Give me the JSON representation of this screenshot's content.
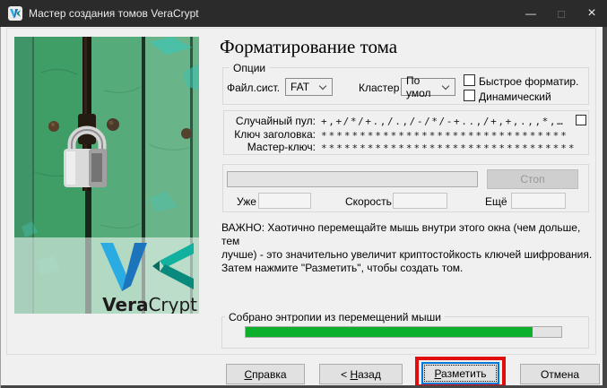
{
  "window": {
    "title": "Мастер создания томов VeraCrypt"
  },
  "icons": {
    "app": "veracrypt-logo",
    "minimize": "—",
    "maximize": "□",
    "close": "×"
  },
  "heading": "Форматирование тома",
  "options_group": {
    "label": "Опции",
    "filesystem_label": "Файл.сист.",
    "filesystem_value": "FAT",
    "cluster_label": "Кластер",
    "cluster_value": "По умол",
    "quick_format_label": "Быстрое форматир.",
    "dynamic_label": "Динамический"
  },
  "random_group": {
    "rows": [
      {
        "label": "Случайный пул:",
        "value": "+,+/*/+.,/.,/-/*/-+..,/+,+,.,,*,…"
      },
      {
        "label": "Ключ заголовка:",
        "value": "********************************"
      },
      {
        "label": "Мастер-ключ:",
        "value": "*********************************"
      }
    ]
  },
  "progress_group": {
    "stop_label": "Стоп",
    "done_label": "Уже",
    "done_value": "",
    "speed_label": "Скорость",
    "speed_value": "",
    "left_label": "Ещё",
    "left_value": ""
  },
  "notice": {
    "line1": "ВАЖНО: Хаотично перемещайте мышь внутри этого окна (чем дольше, тем",
    "line2": "лучше) - это значительно увеличит криптостойкость ключей шифрования.",
    "line3": "Затем нажмите \"Разметить\", чтобы создать том."
  },
  "entropy_group": {
    "label": "Собрано энтропии из перемещений мыши",
    "percent": 91
  },
  "footer": {
    "help": {
      "pre": "",
      "key": "С",
      "rest": "правка"
    },
    "back": {
      "pre": "< ",
      "key": "Н",
      "rest": "азад"
    },
    "format": {
      "pre": "",
      "key": "Р",
      "rest": "азметить"
    },
    "cancel": "Отмена"
  },
  "logo": {
    "vera": "Vera",
    "crypt": "Crypt"
  },
  "colors": {
    "titlebar": "#2b2b2b",
    "entropy_green": "#0cb02c",
    "annotation_red": "#e20c0c",
    "focus_blue": "#0078d7"
  }
}
